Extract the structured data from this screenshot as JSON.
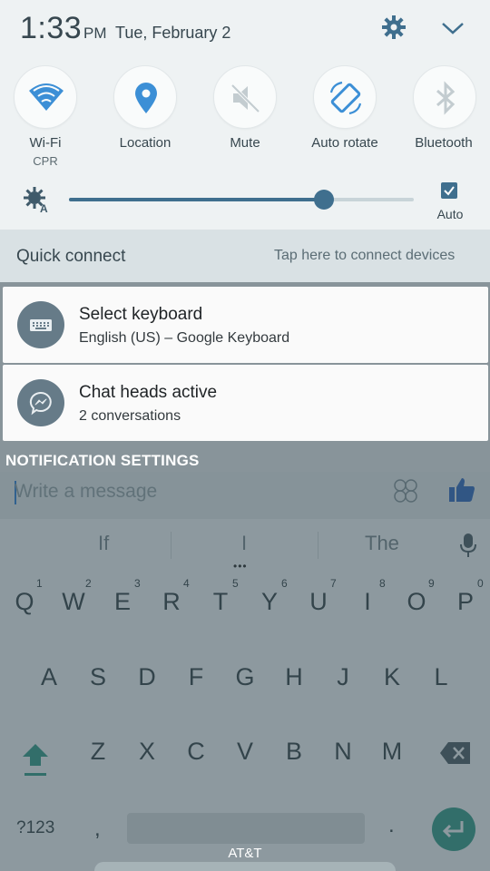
{
  "status": {
    "time": "1:33",
    "ampm": "PM",
    "date": "Tue, February 2"
  },
  "quick_settings": [
    {
      "label": "Wi-Fi",
      "sublabel": "CPR",
      "icon": "wifi-icon"
    },
    {
      "label": "Location",
      "sublabel": "",
      "icon": "location-icon"
    },
    {
      "label": "Mute",
      "sublabel": "",
      "icon": "mute-icon"
    },
    {
      "label": "Auto rotate",
      "sublabel": "",
      "icon": "auto-rotate-icon"
    },
    {
      "label": "Bluetooth",
      "sublabel": "",
      "icon": "bluetooth-icon"
    }
  ],
  "brightness": {
    "level": 0.74,
    "auto_label": "Auto",
    "auto_checked": true
  },
  "quick_connect": {
    "title": "Quick connect",
    "hint": "Tap here to connect devices"
  },
  "notifications": [
    {
      "title": "Select keyboard",
      "subtitle": "English (US) – Google Keyboard",
      "icon": "keyboard-icon"
    },
    {
      "title": "Chat heads active",
      "subtitle": "2 conversations",
      "icon": "messenger-icon"
    }
  ],
  "notification_settings_label": "NOTIFICATION SETTINGS",
  "carrier": "AT&T",
  "background": {
    "message_placeholder": "Write a message",
    "suggestions": [
      "If",
      "I",
      "The"
    ],
    "keyboard": {
      "row1": [
        "Q",
        "W",
        "E",
        "R",
        "T",
        "Y",
        "U",
        "I",
        "O",
        "P"
      ],
      "row1_numbers": [
        "1",
        "2",
        "3",
        "4",
        "5",
        "6",
        "7",
        "8",
        "9",
        "0"
      ],
      "row2": [
        "A",
        "S",
        "D",
        "F",
        "G",
        "H",
        "J",
        "K",
        "L"
      ],
      "row3": [
        "Z",
        "X",
        "C",
        "V",
        "B",
        "N",
        "M"
      ],
      "symbols_key": "?123",
      "comma_key": ",",
      "period_key": "."
    }
  },
  "colors": {
    "accent": "#3c8fd6",
    "slider": "#3f6f8e",
    "enter_key": "#3c9f8c",
    "messenger_like": "#3b6fc0"
  }
}
